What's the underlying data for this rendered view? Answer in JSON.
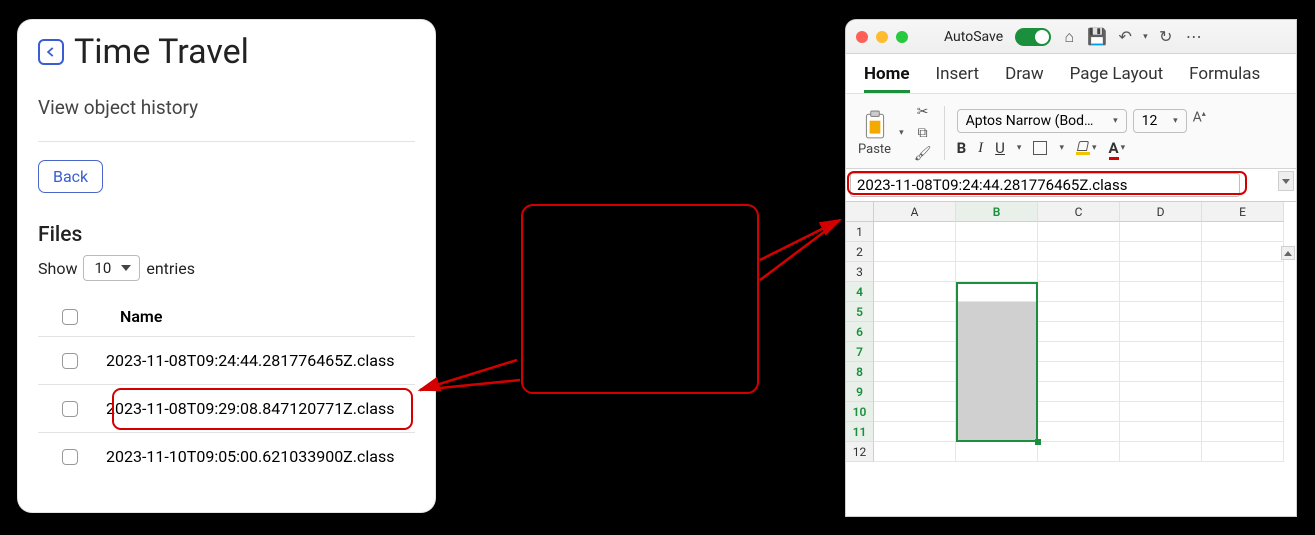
{
  "left_panel": {
    "title": "Time Travel",
    "subtitle": "View object history",
    "back_button": "Back",
    "files_heading": "Files",
    "show_label_pre": "Show",
    "show_value": "10",
    "show_label_post": "entries",
    "columns": {
      "name": "Name"
    },
    "rows": [
      {
        "name": "2023-11-08T09:24:44.281776465Z.class"
      },
      {
        "name": "2023-11-08T09:29:08.847120771Z.class"
      },
      {
        "name": "2023-11-10T09:05:00.621033900Z.class"
      }
    ]
  },
  "excel": {
    "autosave_label": "AutoSave",
    "tabs": [
      "Home",
      "Insert",
      "Draw",
      "Page Layout",
      "Formulas"
    ],
    "active_tab": "Home",
    "paste_label": "Paste",
    "font_name": "Aptos Narrow (Bod…",
    "font_size": "12",
    "formula_bar": "2023-11-08T09:24:44.281776465Z.class",
    "columns": [
      "A",
      "B",
      "C",
      "D",
      "E"
    ],
    "rows": [
      "1",
      "2",
      "3",
      "4",
      "5",
      "6",
      "7",
      "8",
      "9",
      "10",
      "11",
      "12"
    ],
    "selected_column": "B",
    "selected_rows_start": 4,
    "selected_rows_end": 11
  }
}
